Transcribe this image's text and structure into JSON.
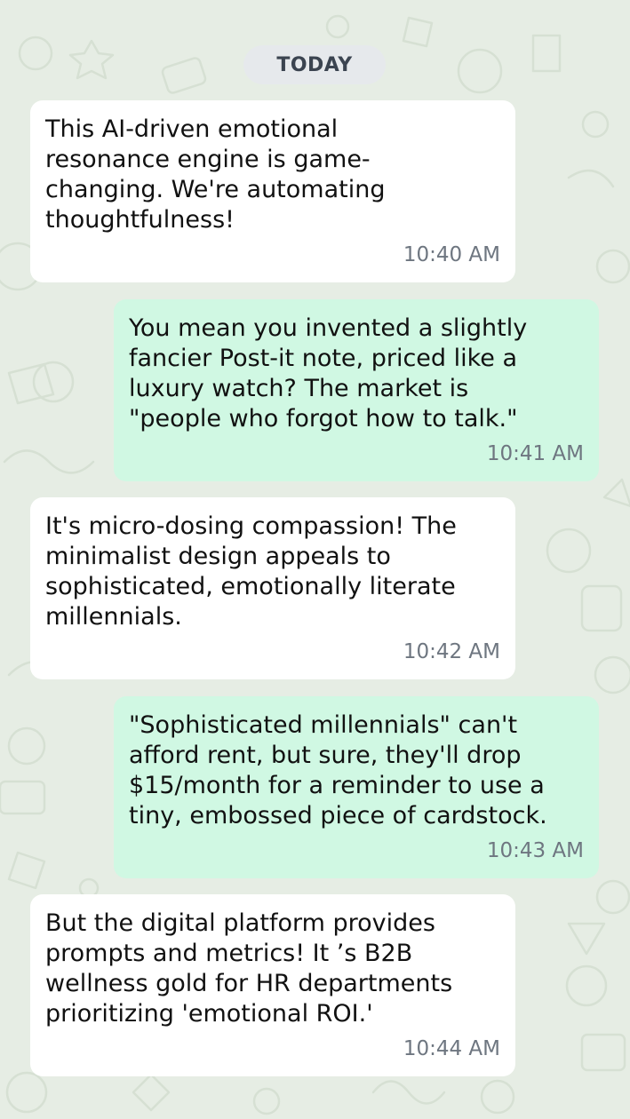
{
  "chat": {
    "date_divider": "TODAY",
    "messages": [
      {
        "direction": "incoming",
        "text": "This AI-driven emotional\nresonance engine is game-\nchanging. We're automating\nthoughtfulness!",
        "time": "10:40 AM"
      },
      {
        "direction": "outgoing",
        "text": "You mean you invented a slightly\nfancier Post-it note, priced like a\nluxury watch? The market is\n\"people who forgot how to talk.\"",
        "time": "10:41 AM"
      },
      {
        "direction": "incoming",
        "text": "It's micro-dosing compassion! The\nminimalist design appeals to\nsophisticated, emotionally literate\nmillennials.",
        "time": "10:42 AM"
      },
      {
        "direction": "outgoing",
        "text": "\"Sophisticated millennials\" can't\nafford rent, but sure, they'll drop\n$15/month for a reminder to use a\ntiny, embossed piece of cardstock.",
        "time": "10:43 AM"
      },
      {
        "direction": "incoming",
        "text": "But the digital platform provides\nprompts and metrics! It ’s B2B\nwellness gold for HR departments\nprioritizing 'emotional ROI.'",
        "time": "10:44 AM"
      }
    ]
  },
  "colors": {
    "wallpaper": "#e6ede4",
    "incoming_bubble": "#ffffff",
    "outgoing_bubble": "#d0f8e3",
    "timestamp": "#6e7680"
  }
}
